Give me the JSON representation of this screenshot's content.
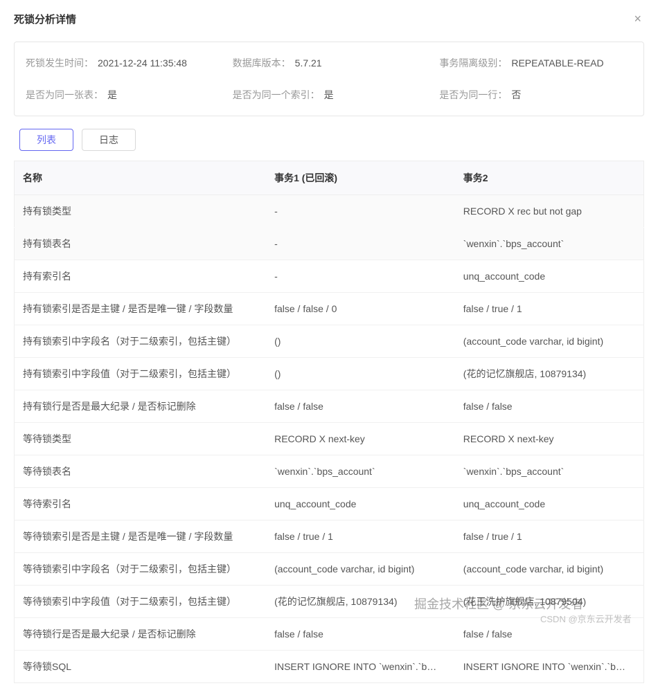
{
  "modal": {
    "title": "死锁分析详情",
    "close_label": "×"
  },
  "info": {
    "time_label": "死锁发生时间：",
    "time_value": "2021-12-24 11:35:48",
    "version_label": "数据库版本：",
    "version_value": "5.7.21",
    "isolation_label": "事务隔离级别：",
    "isolation_value": "REPEATABLE-READ",
    "same_table_label": "是否为同一张表：",
    "same_table_value": "是",
    "same_index_label": "是否为同一个索引：",
    "same_index_value": "是",
    "same_row_label": "是否为同一行：",
    "same_row_value": "否"
  },
  "tabs": {
    "list": "列表",
    "log": "日志"
  },
  "headers": {
    "name": "名称",
    "tx1": "事务1 (已回滚)",
    "tx2": "事务2"
  },
  "rows": [
    {
      "name": "持有锁类型",
      "t1": "-",
      "t2": "RECORD X rec but not gap"
    },
    {
      "name": "持有锁表名",
      "t1": "-",
      "t2": "`wenxin`.`bps_account`"
    },
    {
      "name": "持有索引名",
      "t1": "-",
      "t2": "unq_account_code"
    },
    {
      "name": "持有锁索引是否是主键 / 是否是唯一键 / 字段数量",
      "t1": "false / false / 0",
      "t2": "false / true / 1"
    },
    {
      "name": "持有锁索引中字段名（对于二级索引，包括主键）",
      "t1": "()",
      "t2": "(account_code varchar, id bigint)"
    },
    {
      "name": "持有锁索引中字段值（对于二级索引，包括主键）",
      "t1": "()",
      "t2": "(花的记忆旗舰店, 10879134)"
    },
    {
      "name": "持有锁行是否是最大纪录 / 是否标记删除",
      "t1": "false / false",
      "t2": "false / false"
    },
    {
      "name": "等待锁类型",
      "t1": "RECORD X next-key",
      "t2": "RECORD X next-key"
    },
    {
      "name": "等待锁表名",
      "t1": "`wenxin`.`bps_account`",
      "t2": "`wenxin`.`bps_account`"
    },
    {
      "name": "等待索引名",
      "t1": "unq_account_code",
      "t2": "unq_account_code"
    },
    {
      "name": "等待锁索引是否是主键 / 是否是唯一键 / 字段数量",
      "t1": "false / true / 1",
      "t2": "false / true / 1"
    },
    {
      "name": "等待锁索引中字段名（对于二级索引，包括主键）",
      "t1": "(account_code varchar, id bigint)",
      "t2": "(account_code varchar, id bigint)"
    },
    {
      "name": "等待锁索引中字段值（对于二级索引，包括主键）",
      "t1": "(花的记忆旗舰店, 10879134)",
      "t2": "(花王洗护旗舰店, 10879504)"
    },
    {
      "name": "等待锁行是否是最大纪录 / 是否标记删除",
      "t1": "false / false",
      "t2": "false / false"
    },
    {
      "name": "等待锁SQL",
      "t1": "INSERT IGNORE INTO `wenxin`.`b…",
      "t2": "INSERT IGNORE INTO `wenxin`.`b…"
    }
  ],
  "watermark": {
    "line1": "掘金技术社区 @ 京东云开发者",
    "line2": "CSDN @京东云开发者"
  }
}
